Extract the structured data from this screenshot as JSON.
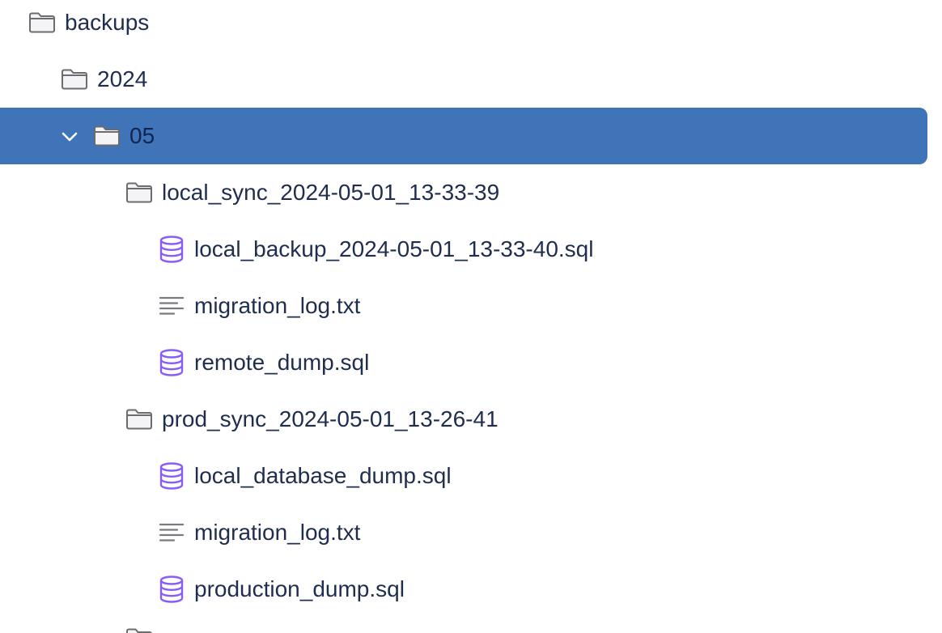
{
  "tree": {
    "rows": [
      {
        "label": "backups",
        "type": "folder",
        "depth": 0,
        "expanded": true,
        "selected": false
      },
      {
        "label": "2024",
        "type": "folder",
        "depth": 1,
        "expanded": true,
        "selected": false
      },
      {
        "label": "05",
        "type": "folder",
        "depth": 2,
        "expanded": true,
        "selected": true
      },
      {
        "label": "local_sync_2024-05-01_13-33-39",
        "type": "folder",
        "depth": 3,
        "expanded": true,
        "selected": false
      },
      {
        "label": "local_backup_2024-05-01_13-33-40.sql",
        "type": "database",
        "depth": 4,
        "selected": false
      },
      {
        "label": "migration_log.txt",
        "type": "text",
        "depth": 4,
        "selected": false
      },
      {
        "label": "remote_dump.sql",
        "type": "database",
        "depth": 4,
        "selected": false
      },
      {
        "label": "prod_sync_2024-05-01_13-26-41",
        "type": "folder",
        "depth": 3,
        "expanded": true,
        "selected": false
      },
      {
        "label": "local_database_dump.sql",
        "type": "database",
        "depth": 4,
        "selected": false
      },
      {
        "label": "migration_log.txt",
        "type": "text",
        "depth": 4,
        "selected": false
      },
      {
        "label": "production_dump.sql",
        "type": "database",
        "depth": 4,
        "selected": false
      }
    ]
  },
  "icons": {
    "folder": "folder-icon",
    "database": "database-icon",
    "text": "text-file-icon",
    "chevron": "chevron-down-icon"
  },
  "colors": {
    "selection": "#3f74b8",
    "text": "#1f2d4e",
    "folder_stroke": "#6b6b70",
    "database": "#8a5cf6",
    "text_file": "#7a7a80"
  }
}
